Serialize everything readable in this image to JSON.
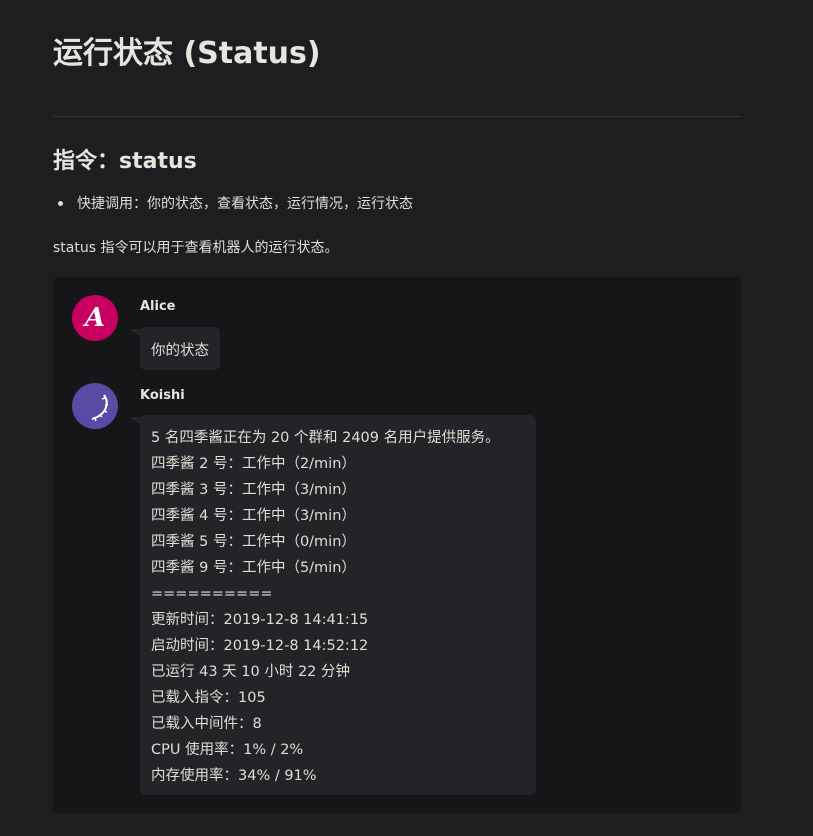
{
  "page_title": "运行状态 (Status)",
  "section_heading": "指令：status",
  "shortcut_item": "快捷调用：你的状态，查看状态，运行情况，运行状态",
  "description": "status 指令可以用于查看机器人的运行状态。",
  "chat": {
    "messages": [
      {
        "sender": "Alice",
        "avatar_letter": "A",
        "avatar_color": "#c8005f",
        "lines": [
          "你的状态"
        ]
      },
      {
        "sender": "Koishi",
        "avatar_color": "#5a4aa6",
        "lines": [
          "5 名四季酱正在为 20 个群和 2409 名用户提供服务。",
          "四季酱 2 号：工作中（2/min）",
          "四季酱 3 号：工作中（3/min）",
          "四季酱 4 号：工作中（3/min）",
          "四季酱 5 号：工作中（0/min）",
          "四季酱 9 号：工作中（5/min）",
          "==========",
          "更新时间：2019-12-8 14:41:15",
          "启动时间：2019-12-8 14:52:12",
          "已运行 43 天 10 小时 22 分钟",
          "已载入指令：105",
          "已载入中间件：8",
          "CPU 使用率：1% / 2%",
          "内存使用率：34% / 91%"
        ]
      }
    ]
  }
}
